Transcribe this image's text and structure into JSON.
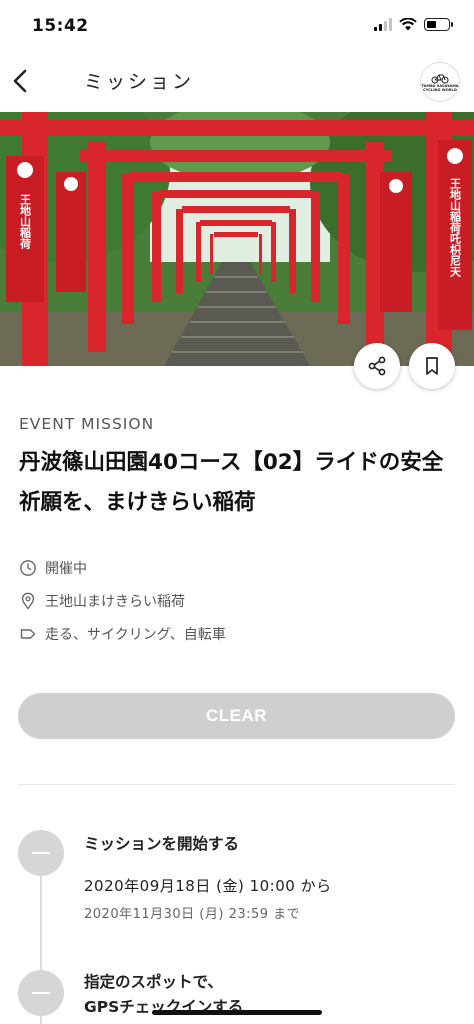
{
  "status_bar": {
    "time": "15:42",
    "battery_level": 0.45
  },
  "nav": {
    "title": "ミッション",
    "logo_text": "TAMBA SASAYAMA\nCYCLING WORLD"
  },
  "hero": {
    "banner_text_left": "王地山稲荷",
    "banner_text_right": "王地山稲荷吒枳尼天",
    "colors": {
      "torii": "#d8262c",
      "foliage": "#3f7a32",
      "sky": "#dfeee0"
    }
  },
  "actions": {
    "share_icon": "share-icon",
    "bookmark_icon": "bookmark-icon"
  },
  "mission": {
    "label": "EVENT MISSION",
    "title": "丹波篠山田園40コース【02】ライドの安全祈願を、まけきらい稲荷",
    "status": "開催中",
    "location": "王地山まけきらい稲荷",
    "tags": "走る、サイクリング、自転車"
  },
  "clear_button": {
    "label": "CLEAR"
  },
  "timeline": {
    "step1": {
      "title": "ミッションを開始する",
      "start": "2020年09月18日 (金) 10:00 から",
      "end": "2020年11月30日 (月) 23:59 まで"
    },
    "step2": {
      "title": "指定のスポットで、",
      "subtitle": "GPSチェックインする"
    }
  }
}
